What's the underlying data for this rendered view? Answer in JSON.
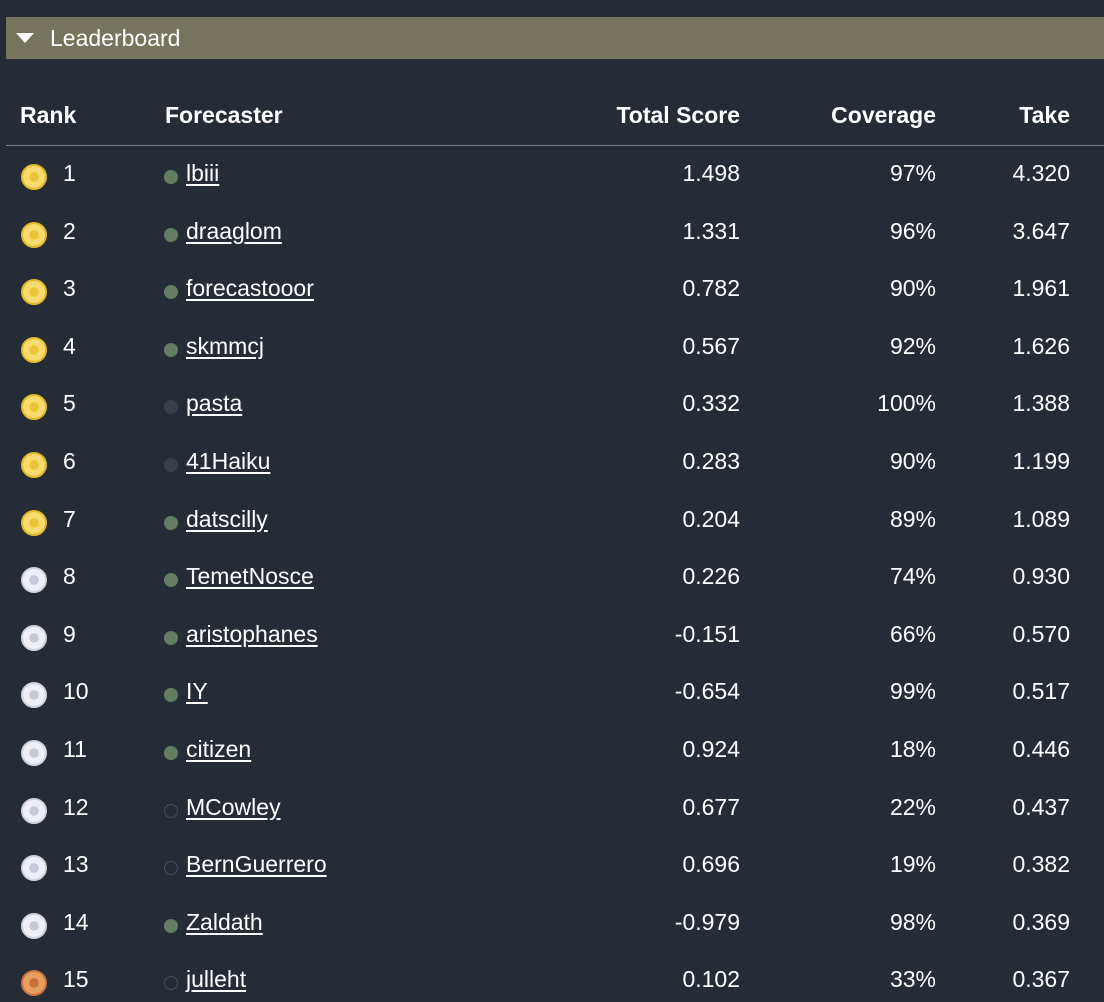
{
  "header": {
    "title": "Leaderboard"
  },
  "columns": {
    "rank": "Rank",
    "forecaster": "Forecaster",
    "total_score": "Total Score",
    "coverage": "Coverage",
    "take": "Take"
  },
  "colors": {
    "background": "#262c36",
    "header_bar": "#77745d",
    "gold": "#f7dc6d",
    "silver": "#eef0f6",
    "bronze": "#e89d63",
    "active_dot": "#637d63"
  },
  "rows": [
    {
      "rank": "1",
      "medal": "gold",
      "status": "active",
      "name": "lbiii",
      "score": "1.498",
      "coverage": "97%",
      "take": "4.320"
    },
    {
      "rank": "2",
      "medal": "gold",
      "status": "active",
      "name": "draaglom",
      "score": "1.331",
      "coverage": "96%",
      "take": "3.647"
    },
    {
      "rank": "3",
      "medal": "gold",
      "status": "active",
      "name": "forecastooor",
      "score": "0.782",
      "coverage": "90%",
      "take": "1.961"
    },
    {
      "rank": "4",
      "medal": "gold",
      "status": "active",
      "name": "skmmcj",
      "score": "0.567",
      "coverage": "92%",
      "take": "1.626"
    },
    {
      "rank": "5",
      "medal": "gold",
      "status": "inactive",
      "name": "pasta",
      "score": "0.332",
      "coverage": "100%",
      "take": "1.388"
    },
    {
      "rank": "6",
      "medal": "gold",
      "status": "inactive",
      "name": "41Haiku",
      "score": "0.283",
      "coverage": "90%",
      "take": "1.199"
    },
    {
      "rank": "7",
      "medal": "gold",
      "status": "active",
      "name": "datscilly",
      "score": "0.204",
      "coverage": "89%",
      "take": "1.089"
    },
    {
      "rank": "8",
      "medal": "silver",
      "status": "active",
      "name": "TemetNosce",
      "score": "0.226",
      "coverage": "74%",
      "take": "0.930"
    },
    {
      "rank": "9",
      "medal": "silver",
      "status": "active",
      "name": "aristophanes",
      "score": "-0.151",
      "coverage": "66%",
      "take": "0.570"
    },
    {
      "rank": "10",
      "medal": "silver",
      "status": "active",
      "name": "IY",
      "score": "-0.654",
      "coverage": "99%",
      "take": "0.517"
    },
    {
      "rank": "11",
      "medal": "silver",
      "status": "active",
      "name": "citizen",
      "score": "0.924",
      "coverage": "18%",
      "take": "0.446"
    },
    {
      "rank": "12",
      "medal": "silver",
      "status": "empty",
      "name": "MCowley",
      "score": "0.677",
      "coverage": "22%",
      "take": "0.437"
    },
    {
      "rank": "13",
      "medal": "silver",
      "status": "empty",
      "name": "BernGuerrero",
      "score": "0.696",
      "coverage": "19%",
      "take": "0.382"
    },
    {
      "rank": "14",
      "medal": "silver",
      "status": "active",
      "name": "Zaldath",
      "score": "-0.979",
      "coverage": "98%",
      "take": "0.369"
    },
    {
      "rank": "15",
      "medal": "bronze",
      "status": "empty",
      "name": "julleht",
      "score": "0.102",
      "coverage": "33%",
      "take": "0.367"
    }
  ]
}
